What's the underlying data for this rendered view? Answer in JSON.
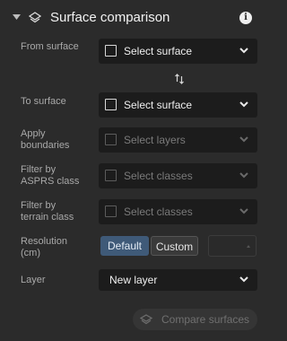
{
  "header": {
    "title": "Surface comparison",
    "info_glyph": "i"
  },
  "from_surface": {
    "label": "From surface",
    "placeholder": "Select surface"
  },
  "to_surface": {
    "label": "To surface",
    "placeholder": "Select surface"
  },
  "apply_boundaries": {
    "label_line1": "Apply",
    "label_line2": "boundaries",
    "placeholder": "Select layers"
  },
  "filter_asprs": {
    "label_line1": "Filter by",
    "label_line2": "ASPRS class",
    "placeholder": "Select classes"
  },
  "filter_terrain": {
    "label_line1": "Filter by",
    "label_line2": "terrain class",
    "placeholder": "Select classes"
  },
  "resolution": {
    "label_line1": "Resolution",
    "label_line2": "(cm)",
    "default_label": "Default",
    "custom_label": "Custom",
    "selected": "Default",
    "value": ""
  },
  "layer": {
    "label": "Layer",
    "value": "New layer"
  },
  "compare_button": {
    "label": "Compare surfaces",
    "enabled": false
  },
  "colors": {
    "background": "#2b2b2b",
    "accent": "#3f5a78",
    "dropdown": "#1c1c1c"
  }
}
